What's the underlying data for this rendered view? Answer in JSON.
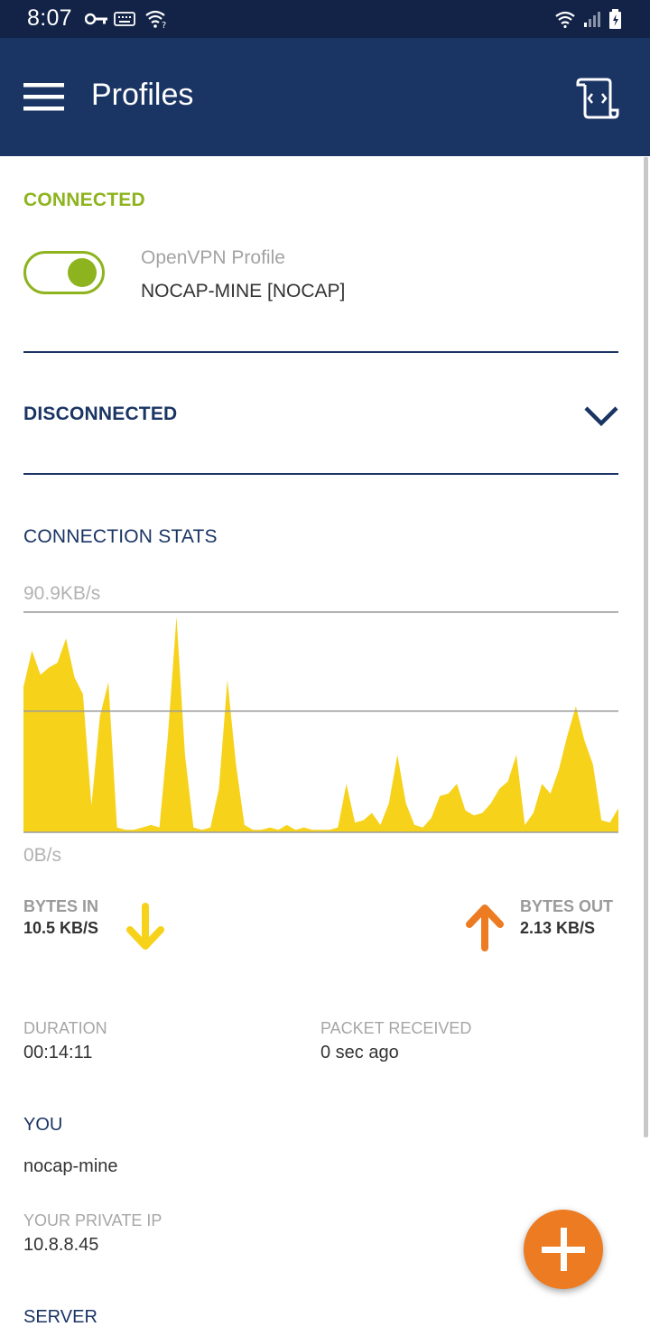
{
  "status_bar": {
    "time": "8:07",
    "icons": [
      "vpn-key-icon",
      "keyboard-icon",
      "wifi-question-icon",
      "wifi-icon",
      "signal-icon",
      "battery-charging-icon"
    ]
  },
  "app_bar": {
    "title": "Profiles",
    "menu_icon": "hamburger-menu-icon",
    "log_icon": "log-scroll-icon"
  },
  "connected": {
    "label": "CONNECTED",
    "toggle_on": true,
    "profile_type": "OpenVPN Profile",
    "profile_name": "NOCAP-MINE [NOCAP]"
  },
  "disconnected": {
    "label": "DISCONNECTED",
    "icon": "chevron-down-icon"
  },
  "stats": {
    "title": "CONNECTION STATS",
    "chart_max_label": "90.9KB/s",
    "chart_min_label": "0B/s",
    "bytes_in_label": "BYTES IN",
    "bytes_in_value": "10.5 KB/S",
    "bytes_out_label": "BYTES OUT",
    "bytes_out_value": "2.13 KB/S",
    "duration_label": "DURATION",
    "duration_value": "00:14:11",
    "packet_label": "PACKET RECEIVED",
    "packet_value": "0 sec ago"
  },
  "you": {
    "title": "YOU",
    "name": "nocap-mine",
    "ip_label": "YOUR PRIVATE IP",
    "ip_value": "10.8.8.45"
  },
  "server": {
    "title": "SERVER"
  },
  "fab": {
    "icon": "plus-icon"
  },
  "colors": {
    "status_bar": "#122347",
    "app_bar": "#1a3464",
    "connected_green": "#8db41e",
    "navy": "#1a3464",
    "chart_yellow": "#f7d21b",
    "arrow_orange": "#ec7b22",
    "fab_orange": "#ec7b22"
  },
  "chart_data": {
    "type": "area",
    "ylim": [
      0,
      90.9
    ],
    "y_unit": "KB/s",
    "mid_gridline": 50,
    "values": [
      60,
      75,
      65,
      68,
      70,
      80,
      64,
      57,
      11,
      48,
      62,
      2,
      1,
      1,
      2,
      3,
      2,
      40,
      89,
      32,
      2,
      1,
      2,
      18,
      63,
      28,
      3,
      1,
      1,
      2,
      1,
      3,
      1,
      2,
      1,
      1,
      1,
      2,
      20,
      4,
      5,
      8,
      3,
      12,
      32,
      12,
      3,
      2,
      6,
      15,
      16,
      20,
      9,
      7,
      8,
      12,
      18,
      21,
      32,
      3,
      8,
      20,
      16,
      26,
      40,
      52,
      38,
      28,
      5,
      4,
      10
    ]
  }
}
